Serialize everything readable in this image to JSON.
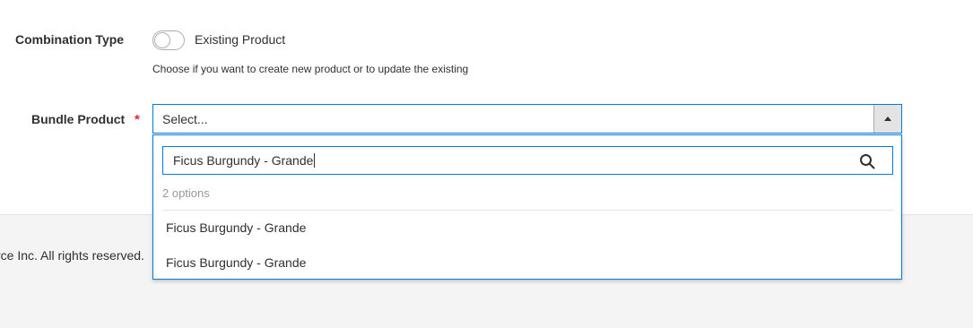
{
  "form": {
    "combination_type": {
      "label": "Combination Type",
      "toggle_label": "Existing Product",
      "toggle_state": "off",
      "hint": "Choose if you want to create new product or to update the existing"
    },
    "bundle_product": {
      "label": "Bundle Product",
      "required_mark": "*",
      "select_placeholder": "Select...",
      "dropdown": {
        "search_value": "Ficus Burgundy - Grande",
        "search_icon": "search-icon",
        "options_count": "2 options",
        "options": [
          {
            "label": "Ficus Burgundy - Grande"
          },
          {
            "label": "Ficus Burgundy - Grande"
          }
        ]
      }
    }
  },
  "footer": {
    "copyright_fragment": "rce Inc. All rights reserved."
  },
  "colors": {
    "accent": "#007bdb",
    "required": "#e02b27",
    "text": "#303030",
    "muted": "#999999",
    "footer_bg": "#f4f4f4"
  }
}
